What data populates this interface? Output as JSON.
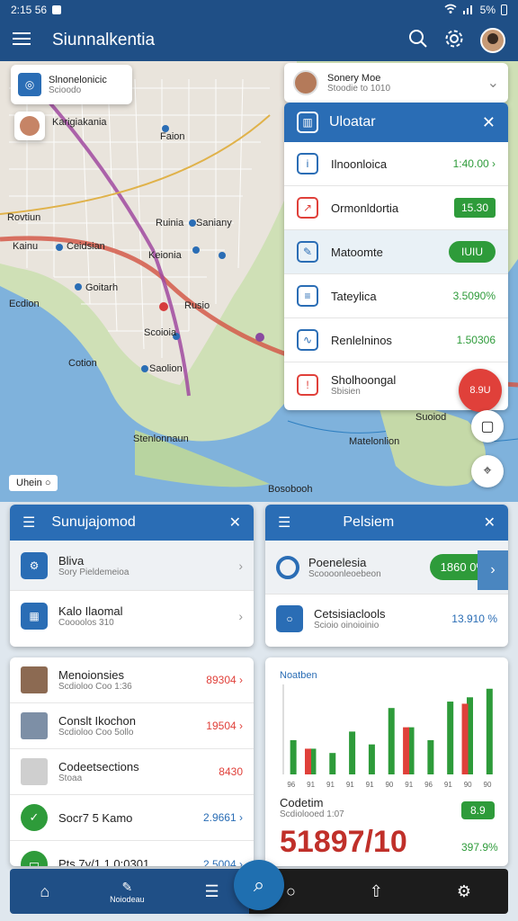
{
  "status": {
    "time": "2:15 56",
    "battery": "5%"
  },
  "appbar": {
    "title": "Siunnalkentia"
  },
  "map": {
    "labels": [
      "Karigiakania",
      "Faion",
      "Rovtiun",
      "Ruinia",
      "Saniany",
      "Kainu",
      "Ceidsian",
      "Keionia",
      "Goitarh",
      "Ecdion",
      "Rusio",
      "Scoioia",
      "Cotion",
      "Saolion",
      "Suoiod",
      "Stenlonnaun",
      "Matelonlion",
      "Bosobooh"
    ],
    "scale_label": "Uhein"
  },
  "location_card": {
    "title": "Slnonelonicic",
    "sub": "Scioodo"
  },
  "user_card": {
    "name": "Sonery Moe",
    "sub": "Stoodie to 1010"
  },
  "panel": {
    "title": "Uloatar",
    "rows": [
      {
        "label": "Ilnoonloica",
        "value": "1:40.00 ›"
      },
      {
        "label": "Ormonldortia",
        "value": "15.30"
      },
      {
        "label": "Matoomte",
        "value": "IUIU"
      },
      {
        "label": "Tateylica",
        "value": "3.5090%"
      },
      {
        "label": "Renlelninos",
        "value": "1.50306"
      },
      {
        "label": "Sholhoongal",
        "sub": "Sbisien",
        "value": "8.9U"
      }
    ]
  },
  "left_panel": {
    "title": "Sunujajomod",
    "items": [
      {
        "title": "Bliva",
        "sub": "Sory Pieldemeioa"
      },
      {
        "title": "Kalo Ilaomal",
        "sub": "Coooolos 310"
      }
    ],
    "list": [
      {
        "title": "Menoionsies",
        "sub": "Scdioloo Coo 1:36",
        "value": "89304 ›"
      },
      {
        "title": "Conslt Ikochon",
        "sub": "Scdioloo Coo 5ollo",
        "value": "19504 ›"
      },
      {
        "title": "Codeetsections",
        "sub": "Stoaa",
        "value": "8430"
      },
      {
        "title": "Socr7 5 Kamo",
        "sub": "",
        "value": "2.9661 ›"
      },
      {
        "title": "Pts 7y/1 1 0:0301",
        "sub": "",
        "value": "2.5004 ›"
      }
    ]
  },
  "right_panel": {
    "title": "Pelsiem",
    "item1": {
      "title": "Poenelesia",
      "sub": "Scoooonleoebeon",
      "pill": "1860 0%"
    },
    "item2": {
      "title": "Cetsisiaclools",
      "sub": "Scioio oinoioinio",
      "value": "13.910 %"
    },
    "chart_title": "Noatben",
    "summary": {
      "title": "Codetim",
      "sub": "Scdiolooed 1:07",
      "big": "51897/10",
      "badge": "8.9",
      "pct": "397.9%"
    }
  },
  "chart_data": {
    "type": "bar",
    "title": "Noatben",
    "categories": [
      "96",
      "91",
      "91",
      "91",
      "91",
      "90",
      "91",
      "96",
      "91",
      "90",
      "90"
    ],
    "series": [
      {
        "values": [
          1.6,
          1.2,
          1.0,
          2.0,
          1.4,
          3.1,
          2.2,
          1.6,
          3.4,
          3.6,
          4.0
        ]
      },
      {
        "values": [
          0,
          1.2,
          0,
          0,
          0,
          0,
          2.2,
          0,
          0,
          3.3,
          0
        ]
      }
    ],
    "colors": [
      "#2e9b3a",
      "#e0403a"
    ]
  },
  "nav": {
    "home_label": "Noiodeau"
  }
}
